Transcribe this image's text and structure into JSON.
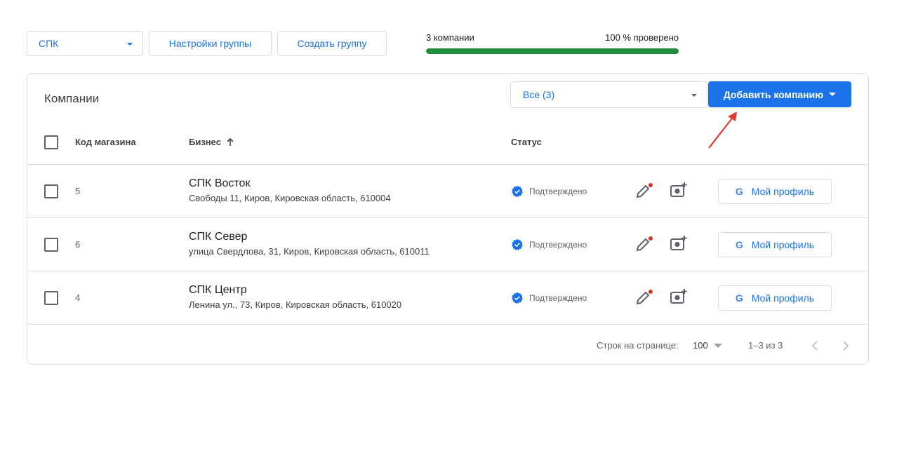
{
  "toolbar": {
    "group_select": "СПК",
    "group_settings_label": "Настройки группы",
    "create_group_label": "Создать группу"
  },
  "progress": {
    "count_label": "3 компании",
    "percent_label": "100 % проверено",
    "value_percent": 100,
    "color": "#1e8e3e"
  },
  "card": {
    "title": "Компании",
    "filter_select": "Все (3)",
    "add_button_label": "Добавить компанию",
    "accent_color": "#1a73e8"
  },
  "table": {
    "headers": {
      "code": "Код магазина",
      "business": "Бизнес",
      "status": "Статус"
    },
    "rows": [
      {
        "code": "5",
        "name": "СПК Восток",
        "address": "Свободы 11, Киров, Кировская область, 610004",
        "status": "Подтверждено",
        "profile_label": "Мой профиль"
      },
      {
        "code": "6",
        "name": "СПК Север",
        "address": "улица Свердлова, 31, Киров, Кировская область, 610011",
        "status": "Подтверждено",
        "profile_label": "Мой профиль"
      },
      {
        "code": "4",
        "name": "СПК Центр",
        "address": "Ленина ул., 73, Киров, Кировская область, 610020",
        "status": "Подтверждено",
        "profile_label": "Мой профиль"
      }
    ]
  },
  "pagination": {
    "rows_per_page_label": "Строк на странице:",
    "rows_per_page_value": "100",
    "range": "1–3 из 3"
  },
  "icons": {
    "sort": "arrow-up-icon",
    "verified": "verified-badge-icon",
    "edit": "pencil-icon",
    "add_photo": "add-photo-icon",
    "google": "google-g-icon",
    "annotation": "red-arrow-icon",
    "annotation_color": "#e0392d"
  }
}
